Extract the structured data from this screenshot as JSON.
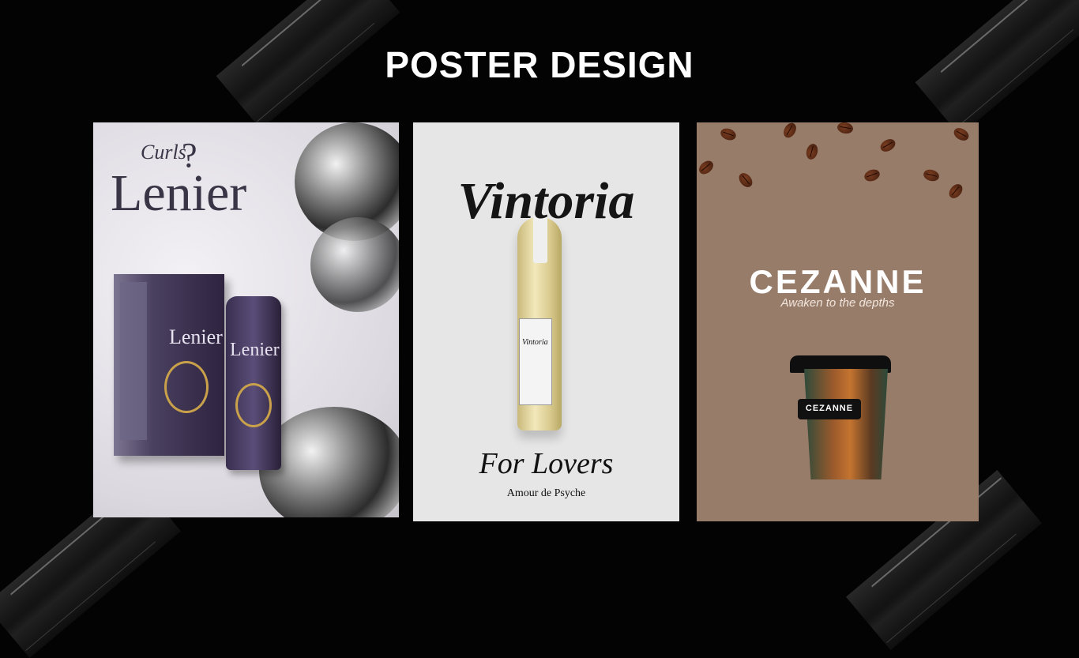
{
  "page": {
    "title": "POSTER DESIGN"
  },
  "posters": [
    {
      "brand_small": "Curls",
      "brand": "Lenier",
      "package_name": "Lenier",
      "tube_name": "Lenier"
    },
    {
      "brand": "Vintoria",
      "label_text": "Vintoria",
      "tagline": "For Lovers",
      "subtitle": "Amour de Psyche"
    },
    {
      "brand": "CEZANNE",
      "tagline": "Awaken to the depths",
      "cup_label": "CEZANNE"
    }
  ]
}
